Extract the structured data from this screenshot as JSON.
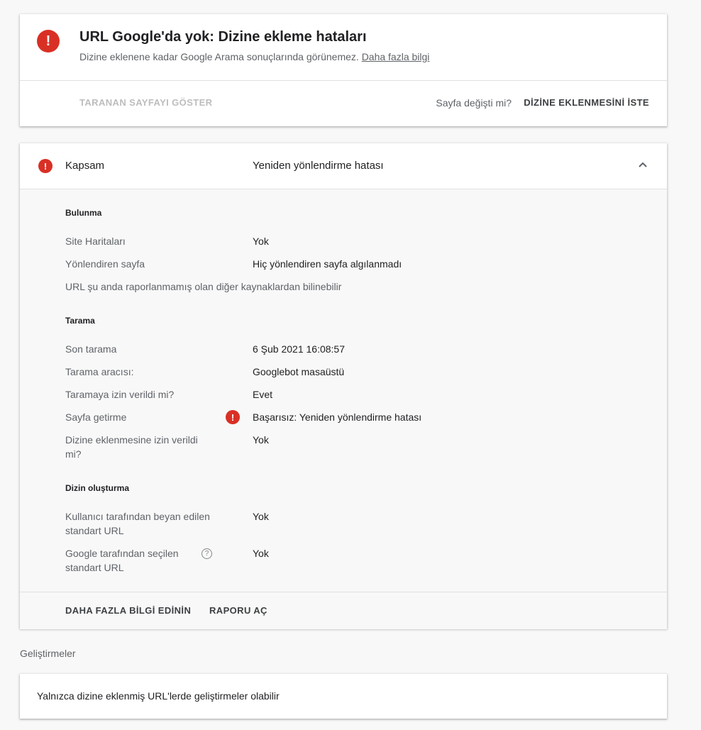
{
  "status": {
    "title": "URL Google'da yok: Dizine ekleme hataları",
    "subtitle": "Dizine eklenene kadar Google Arama sonuçlarında görünemez.",
    "learn_more": "Daha fazla bilgi",
    "view_crawled": "TARANAN SAYFAYI GÖSTER",
    "changed_question": "Sayfa değişti mi?",
    "request_indexing": "DİZİNE EKLENMESİNİ İSTE"
  },
  "coverage": {
    "label": "Kapsam",
    "value": "Yeniden yönlendirme hatası",
    "discovery": {
      "title": "Bulunma",
      "rows": [
        {
          "label": "Site Haritaları",
          "value": "Yok"
        },
        {
          "label": "Yönlendiren sayfa",
          "value": "Hiç yönlendiren sayfa algılanmadı"
        }
      ],
      "note": "URL şu anda raporlanmamış olan diğer kaynaklardan bilinebilir"
    },
    "crawl": {
      "title": "Tarama",
      "rows": [
        {
          "label": "Son tarama",
          "value": "6 Şub 2021 16:08:57"
        },
        {
          "label": "Tarama aracısı:",
          "value": "Googlebot masaüstü"
        },
        {
          "label": "Taramaya izin verildi mi?",
          "value": "Evet"
        },
        {
          "label": "Sayfa getirme",
          "value": "Başarısız: Yeniden yönlendirme hatası"
        },
        {
          "label": "Dizine eklenmesine izin verildi mi?",
          "value": "Yok"
        }
      ]
    },
    "indexing": {
      "title": "Dizin oluşturma",
      "rows": [
        {
          "label": "Kullanıcı tarafından beyan edilen standart URL",
          "value": "Yok"
        },
        {
          "label": "Google tarafından seçilen standart URL",
          "value": "Yok"
        }
      ]
    },
    "footer": {
      "learn_more": "DAHA FAZLA BİLGİ EDİNİN",
      "open_report": "RAPORU AÇ"
    }
  },
  "enhancements": {
    "title": "Geliştirmeler",
    "text": "Yalnızca dizine eklenmiş URL'lerde geliştirmeler olabilir"
  }
}
